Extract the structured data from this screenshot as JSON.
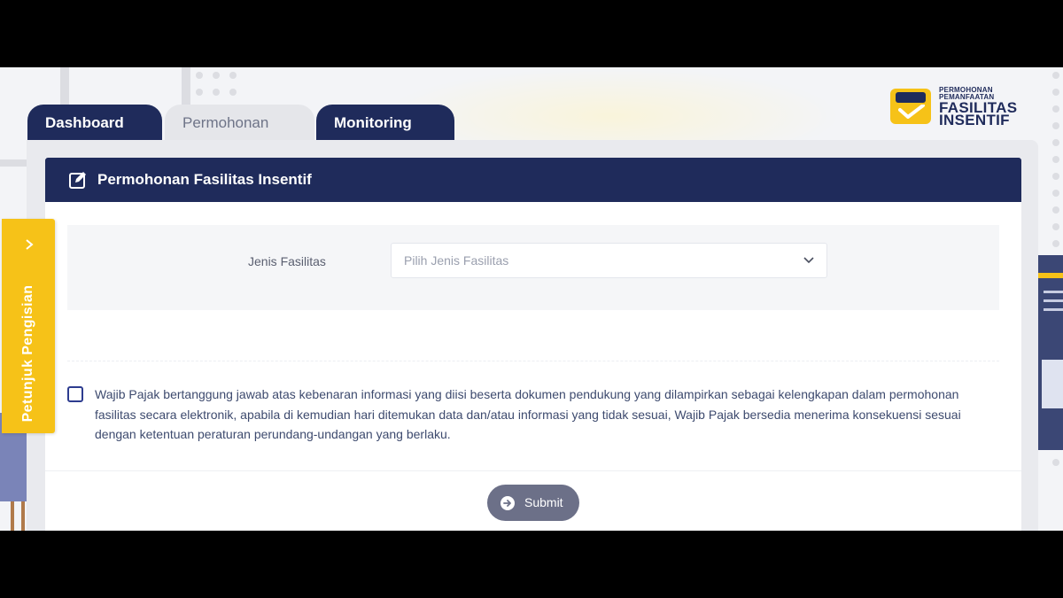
{
  "tabs": [
    {
      "label": "Dashboard",
      "active": false
    },
    {
      "label": "Permohonan",
      "active": true
    },
    {
      "label": "Monitoring",
      "active": false
    }
  ],
  "logo": {
    "line1": "PERMOHONAN",
    "line2": "PEMANFAATAN",
    "line3": "FASILITAS",
    "line4": "INSENTIF"
  },
  "side_guide": {
    "label": "Petunjuk Pengisian",
    "icon": "chevron-right-icon"
  },
  "panel": {
    "title": "Permohonan Fasilitas Insentif",
    "icon": "edit-icon"
  },
  "form": {
    "jenis_fasilitas_label": "Jenis Fasilitas",
    "jenis_fasilitas_placeholder": "Pilih Jenis Fasilitas"
  },
  "agreement": {
    "checked": false,
    "text": "Wajib Pajak bertanggung jawab atas kebenaran informasi yang diisi beserta dokumen pendukung yang dilampirkan sebagai kelengkapan dalam permohonan fasilitas secara elektronik, apabila di kemudian hari ditemukan data dan/atau informasi yang tidak sesuai, Wajib Pajak bersedia menerima konsekuensi sesuai dengan ketentuan peraturan perundang-undangan yang berlaku."
  },
  "submit": {
    "label": "Submit",
    "icon": "arrow-right-circle-icon"
  },
  "colors": {
    "navy": "#1f2b5b",
    "accent_yellow": "#f6c218",
    "submit_gray": "#6c7088",
    "inactive_tab": "#e5e6ea"
  }
}
